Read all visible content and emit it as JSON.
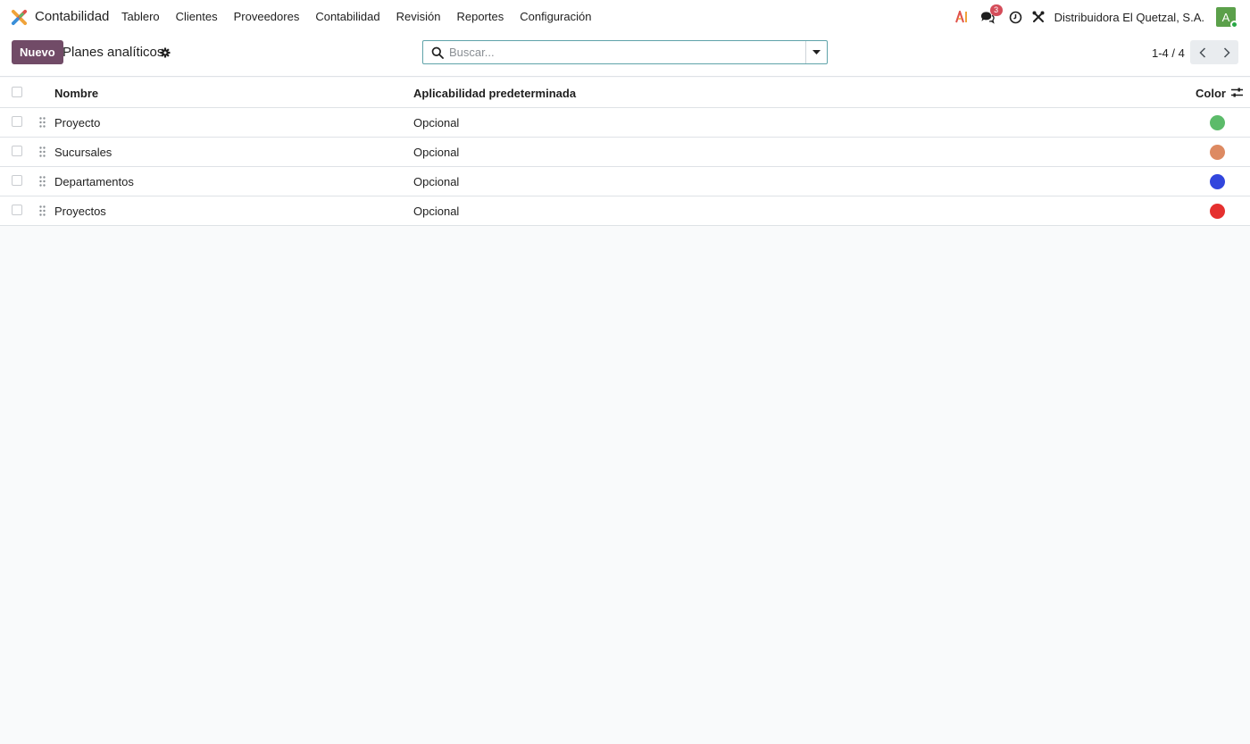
{
  "app": {
    "name": "Contabilidad",
    "menu": [
      "Tablero",
      "Clientes",
      "Proveedores",
      "Contabilidad",
      "Revisión",
      "Reportes",
      "Configuración"
    ],
    "messages_badge": "3",
    "company": "Distribuidora El Quetzal, S.A.",
    "avatar_letter": "A"
  },
  "control": {
    "new_label": "Nuevo",
    "title": "Planes analíticos",
    "search_placeholder": "Buscar...",
    "pager": "1-4 / 4"
  },
  "table": {
    "headers": {
      "name": "Nombre",
      "applicability": "Aplicabilidad predeterminada",
      "color": "Color"
    },
    "rows": [
      {
        "name": "Proyecto",
        "applicability": "Opcional",
        "color": "#5cbb6a"
      },
      {
        "name": "Sucursales",
        "applicability": "Opcional",
        "color": "#dd8a62"
      },
      {
        "name": "Departamentos",
        "applicability": "Opcional",
        "color": "#3246dd"
      },
      {
        "name": "Proyectos",
        "applicability": "Opcional",
        "color": "#e5302f"
      }
    ]
  },
  "colors": {
    "brand": "#714b67",
    "search_border": "#5fa3a9",
    "badge": "#d44c59",
    "avatar": "#5ba04a"
  }
}
